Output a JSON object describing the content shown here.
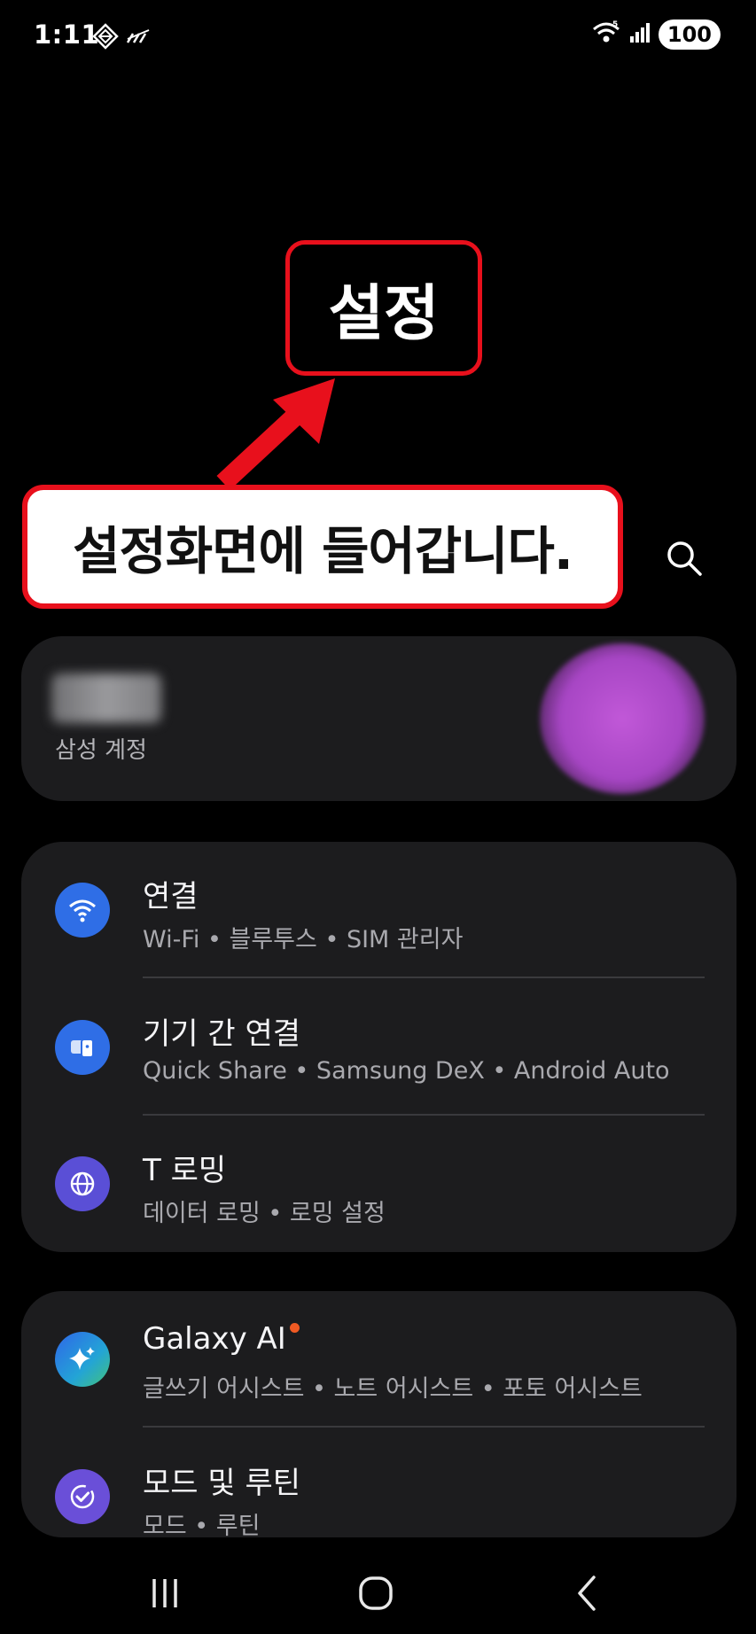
{
  "status_bar": {
    "time": "1:11",
    "battery": "100"
  },
  "page_title": "설정",
  "annotation": "설정화면에 들어갑니다.",
  "account": {
    "subtitle": "삼성 계정"
  },
  "groups": [
    {
      "items": [
        {
          "title": "연결",
          "subtitle": "Wi-Fi • 블루투스 • SIM 관리자",
          "icon": "wifi-icon",
          "color": "#2f6ee6"
        },
        {
          "title": "기기 간 연결",
          "subtitle": "Quick Share • Samsung DeX • Android Auto",
          "icon": "devices-icon",
          "color": "#2f6ee6"
        },
        {
          "title": "T 로밍",
          "subtitle": "데이터 로밍 • 로밍 설정",
          "icon": "globe-icon",
          "color": "#5a4fd6"
        }
      ]
    },
    {
      "items": [
        {
          "title": "Galaxy AI",
          "subtitle": "글쓰기 어시스트 • 노트 어시스트 • 포토 어시스트",
          "icon": "sparkle-icon",
          "color": "#3a7ee8"
        },
        {
          "title": "모드 및 루틴",
          "subtitle": "모드 • 루틴",
          "icon": "routine-check-icon",
          "color": "#6a4fd8"
        }
      ]
    }
  ],
  "colors": {
    "annotation_red": "#e8101c",
    "card_bg": "#1c1c1e",
    "new_badge": "#f05a23"
  }
}
